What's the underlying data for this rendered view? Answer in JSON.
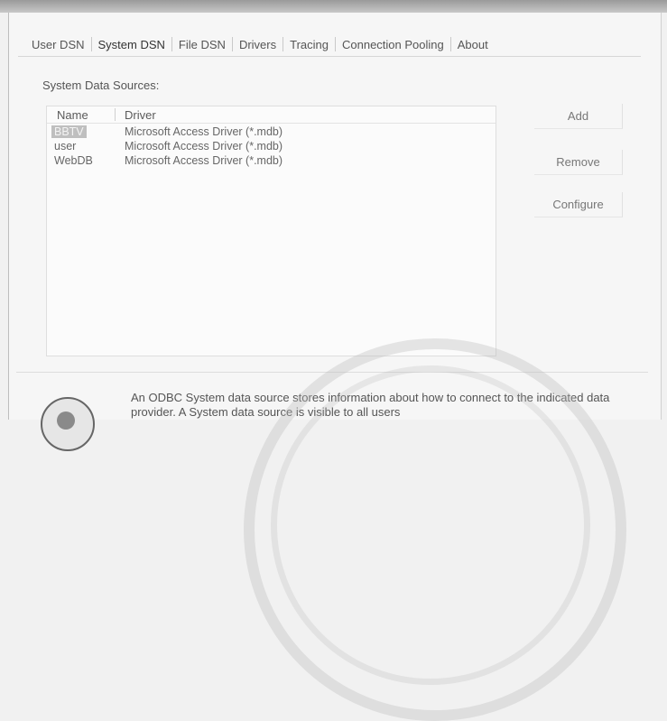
{
  "tabs": [
    {
      "label": "User DSN"
    },
    {
      "label": "System DSN"
    },
    {
      "label": "File DSN"
    },
    {
      "label": "Drivers"
    },
    {
      "label": "Tracing"
    },
    {
      "label": "Connection Pooling"
    },
    {
      "label": "About"
    }
  ],
  "section_label": "System Data Sources:",
  "list": {
    "headers": {
      "name": "Name",
      "driver": "Driver"
    },
    "rows": [
      {
        "name": "BBTV",
        "driver": "Microsoft Access Driver (*.mdb)"
      },
      {
        "name": "user",
        "driver": "Microsoft Access Driver (*.mdb)"
      },
      {
        "name": "WebDB",
        "driver": "Microsoft Access Driver (*.mdb)"
      }
    ]
  },
  "buttons": {
    "add": "Add",
    "remove": "Remove",
    "configure": "Configure"
  },
  "info": {
    "text": "An ODBC System data source stores information about how to connect to the indicated data provider. A System data source is visible to all users"
  }
}
